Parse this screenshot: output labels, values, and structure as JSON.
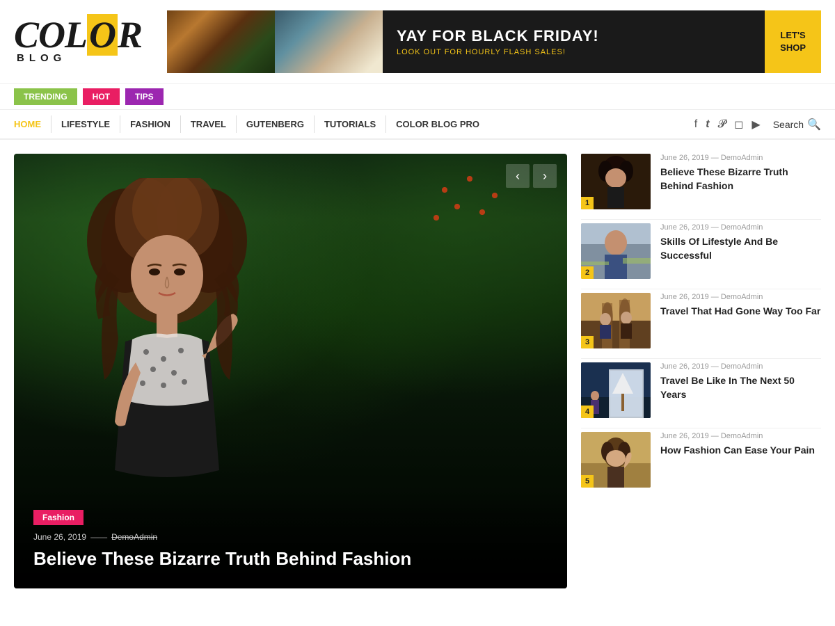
{
  "header": {
    "logo": {
      "color_text": "COLOR",
      "blog_text": "BLOG"
    },
    "ad": {
      "headline": "YAY FOR BLACK FRIDAY!",
      "subtext": "LOOK OUT FOR HOURLY FLASH SALES!",
      "cta": "LET'S\nSHOP"
    }
  },
  "tag_nav": {
    "items": [
      {
        "label": "TRENDING",
        "class": "trending"
      },
      {
        "label": "HOT",
        "class": "hot"
      },
      {
        "label": "TIPS",
        "class": "tips"
      }
    ]
  },
  "main_nav": {
    "items": [
      {
        "label": "HOME",
        "active": true
      },
      {
        "label": "LIFESTYLE"
      },
      {
        "label": "FASHION"
      },
      {
        "label": "TRAVEL"
      },
      {
        "label": "GUTENBERG"
      },
      {
        "label": "TUTORIALS"
      },
      {
        "label": "COLOR BLOG PRO"
      }
    ],
    "social": [
      "f",
      "t",
      "p",
      "ig",
      "yt"
    ],
    "search_label": "Search"
  },
  "slider": {
    "category": "Fashion",
    "date": "June 26, 2019",
    "author": "DemoAdmin",
    "title": "Believe These Bizarre Truth Behind Fashion",
    "arrow_prev": "‹",
    "arrow_next": "›"
  },
  "sidebar": {
    "posts": [
      {
        "num": "1",
        "date": "June 26, 2019",
        "author": "DemoAdmin",
        "title": "Believe These Bizarre Truth Behind Fashion",
        "thumb_class": "thumb-1"
      },
      {
        "num": "2",
        "date": "June 26, 2019",
        "author": "DemoAdmin",
        "title": "Skills Of Lifestyle And Be Successful",
        "thumb_class": "thumb-2"
      },
      {
        "num": "3",
        "date": "June 26, 2019",
        "author": "DemoAdmin",
        "title": "Travel That Had Gone Way Too Far",
        "thumb_class": "thumb-3"
      },
      {
        "num": "4",
        "date": "June 26, 2019",
        "author": "DemoAdmin",
        "title": "Travel Be Like In The Next 50 Years",
        "thumb_class": "thumb-4"
      },
      {
        "num": "5",
        "date": "June 26, 2019",
        "author": "DemoAdmin",
        "title": "How Fashion Can Ease Your Pain",
        "thumb_class": "thumb-5"
      }
    ]
  },
  "colors": {
    "accent": "#f5c518",
    "hot": "#E91E63",
    "trending": "#8BC34A",
    "tips": "#9C27B0"
  }
}
